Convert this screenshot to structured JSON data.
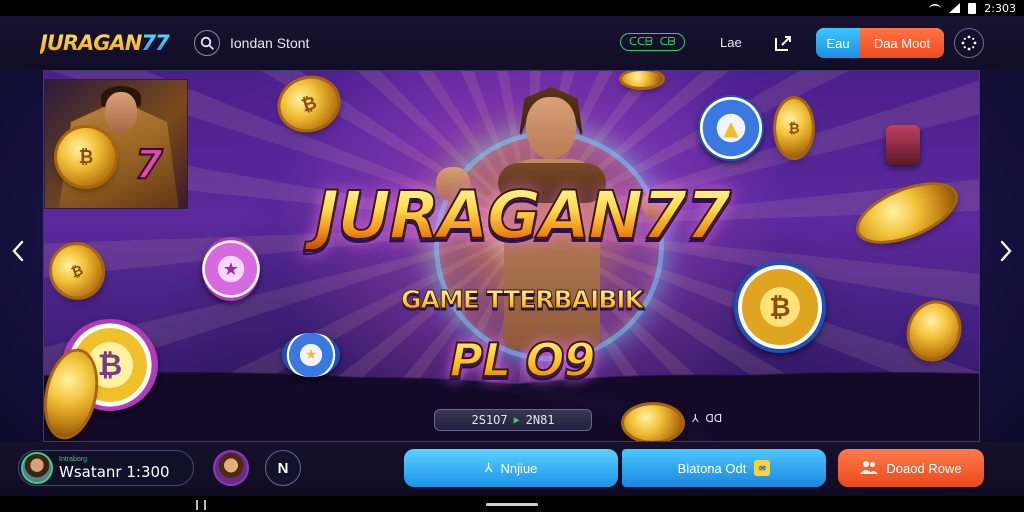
{
  "status_bar": {
    "time": "2:303"
  },
  "header": {
    "logo": {
      "main": "JURAGAN",
      "accent": "77"
    },
    "search": {
      "placeholder": "Iondan Stont",
      "icon": "search-icon"
    },
    "status_pill": "ᑕᑕᗷ ᑕᗷ",
    "language": "Lae",
    "share_icon": "share-icon",
    "cta": {
      "left_label": "Eau",
      "right_label": "Daa Moot"
    },
    "menu_icon": "menu-dots-icon"
  },
  "banner": {
    "title": "JURAGAN77",
    "subtitle": "GAME TTERBAIBIK",
    "promo_code": "PL O9",
    "info_pill": {
      "left": "2S1O7",
      "right": "2N81"
    },
    "corner_badge": "⅄ ᗡᗡ",
    "thumbnail_number": "7",
    "colors": {
      "gold": "#ffc93a",
      "purple": "#5b2a9c",
      "cyan": "#78dcff"
    }
  },
  "navigation": {
    "prev_icon": "chevron-left-icon",
    "next_icon": "chevron-right-icon"
  },
  "bottom_bar": {
    "user": {
      "tag": "Intraborg",
      "balance_label": "Wsatanr",
      "balance_value": "1:300"
    },
    "n_button": "N",
    "buttons": [
      {
        "icon": "⅄",
        "label": "Nnjiue"
      },
      {
        "label": "Blatona Odt"
      },
      {
        "icon": "person-group-icon",
        "label": "Doaod Rowe"
      }
    ]
  }
}
